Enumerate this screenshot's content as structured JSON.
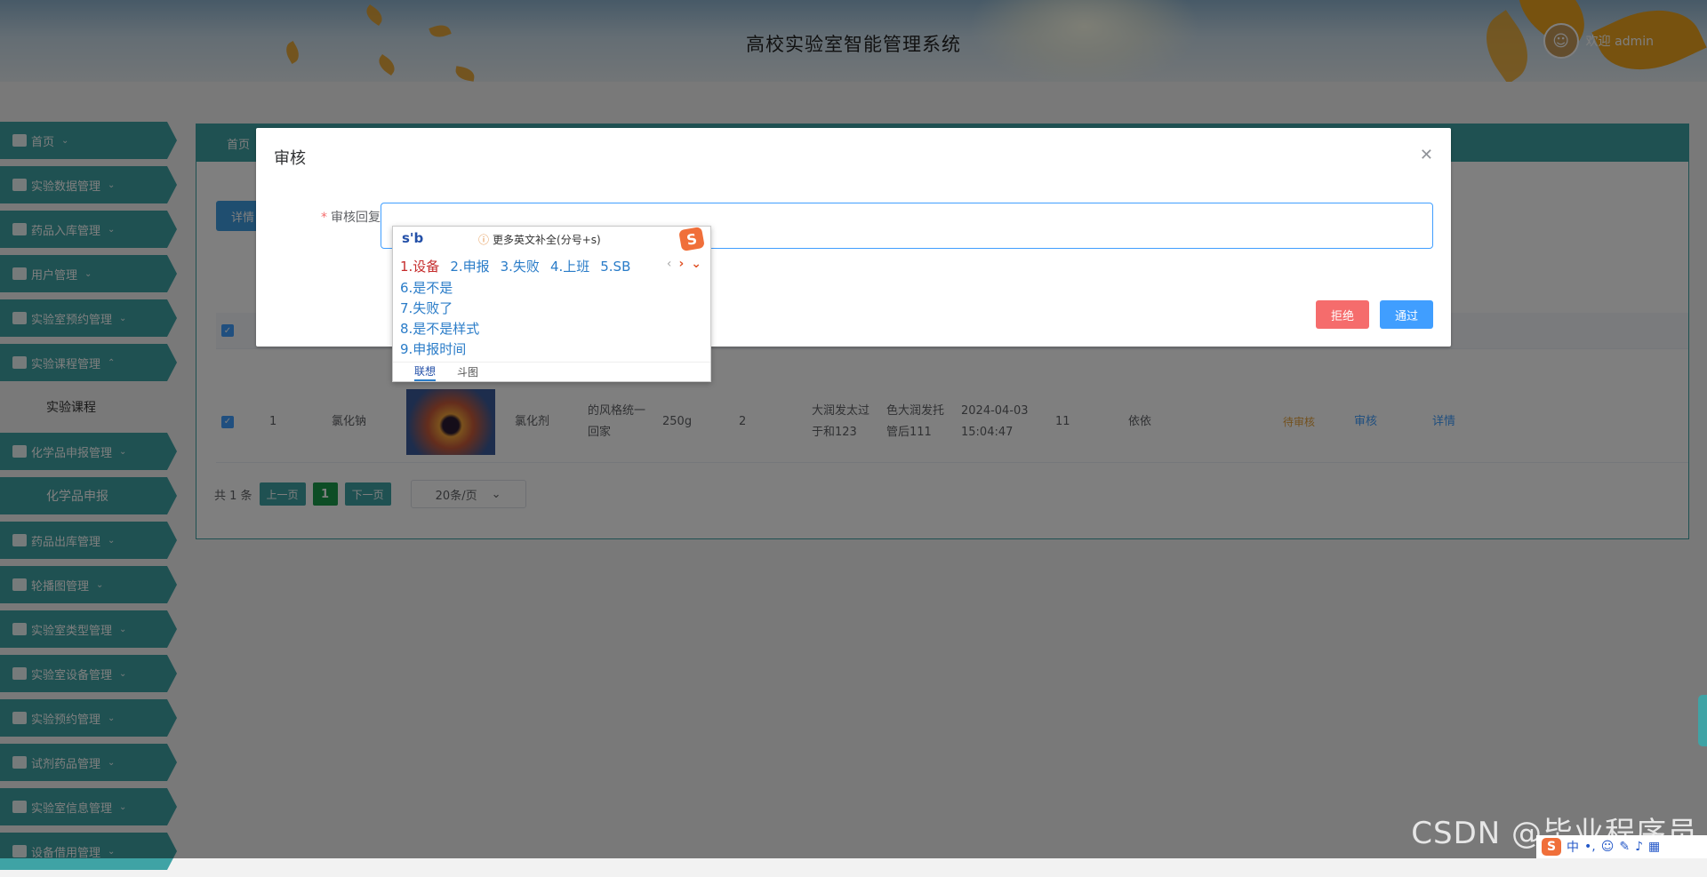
{
  "header": {
    "title": "高校实验室智能管理系统",
    "welcome": "欢迎 admin",
    "avatar_icon": "user-avatar-icon"
  },
  "sidebar": {
    "items": [
      {
        "label": "首页",
        "icon": "home-icon"
      },
      {
        "label": "实验数据管理",
        "icon": "book-icon"
      },
      {
        "label": "药品入库管理",
        "icon": "box-icon"
      },
      {
        "label": "用户管理",
        "icon": "user-icon"
      },
      {
        "label": "实验室预约管理",
        "icon": "grid-icon"
      },
      {
        "label": "实验课程管理",
        "icon": "list-icon",
        "expanded": true,
        "sub": "实验课程"
      },
      {
        "label": "化学品申报管理",
        "icon": "table-icon",
        "sub": "化学品申报"
      },
      {
        "label": "药品出库管理",
        "icon": "box-icon"
      },
      {
        "label": "轮播图管理",
        "icon": "print-icon"
      },
      {
        "label": "实验室类型管理",
        "icon": "book-icon"
      },
      {
        "label": "实验室设备管理",
        "icon": "server-icon"
      },
      {
        "label": "实验预约管理",
        "icon": "clock-icon"
      },
      {
        "label": "试剂药品管理",
        "icon": "gift-icon"
      },
      {
        "label": "实验室信息管理",
        "icon": "doc-icon"
      },
      {
        "label": "设备借用管理",
        "icon": "hammer-icon"
      }
    ]
  },
  "main": {
    "breadcrumb": "首页",
    "toolbar_button": "详情",
    "row": {
      "index": "1",
      "name": "氯化钠",
      "category": "氯化剂",
      "desc_1": "的风格统一",
      "desc_2": "回家",
      "qty": "250g",
      "count": "2",
      "col8_1": "大润发太过",
      "col8_2": "于和123",
      "col9_1": "色大润发托",
      "col9_2": "管后111",
      "date": "2024-04-03",
      "time": "15:04:47",
      "num": "11",
      "person": "依依",
      "status": "待审核",
      "audit_link": "审核",
      "detail_link": "详情"
    },
    "pager": {
      "total": "共 1 条",
      "prev": "上一页",
      "current": "1",
      "next": "下一页",
      "page_size": "20条/页"
    }
  },
  "dialog": {
    "title": "审核",
    "label": "审核回复",
    "reply_value": "",
    "reject": "拒绝",
    "pass": "通过"
  },
  "ime": {
    "input": "s'b",
    "hint": "更多英文补全(分号+s)",
    "candidates_row": [
      "1.设备",
      "2.申报",
      "3.失败",
      "4.上班",
      "5.SB"
    ],
    "candidates_list": [
      "6.是不是",
      "7.失败了",
      "8.是不是样式",
      "9.申报时间"
    ],
    "tabs": [
      "联想",
      "斗图"
    ]
  },
  "watermark": "CSDN @毕业程序员",
  "tray": {
    "lang": "中"
  },
  "colors": {
    "teal": "#3fa3a5",
    "primary": "#409eff",
    "danger": "#f56c6c",
    "warning": "#e6a23c"
  }
}
